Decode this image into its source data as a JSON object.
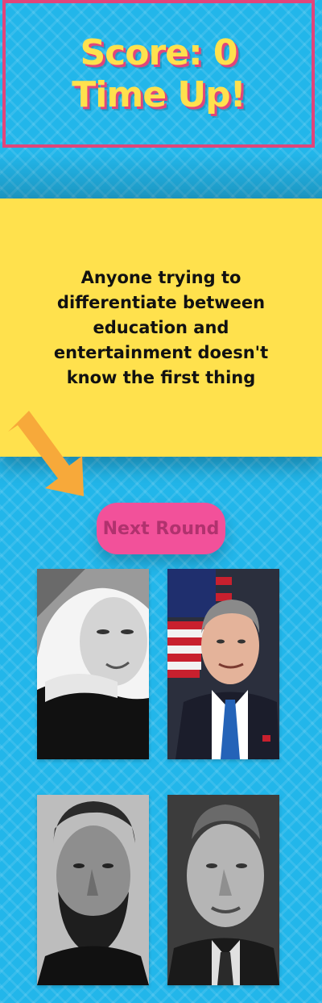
{
  "header": {
    "score_line": "Score: 0",
    "status_line": "Time Up!"
  },
  "quote": {
    "text": "Anyone trying to differentiate between education and entertainment doesn't know the first thing"
  },
  "controls": {
    "next_round_label": "Next Round"
  },
  "colors": {
    "background": "#22b6ea",
    "accent_yellow": "#ffe14d",
    "accent_pink": "#f2519a",
    "border_pink": "#e0457b",
    "arrow_orange": "#f7a93a"
  },
  "portraits": [
    {
      "icon": "portrait-woman-photo"
    },
    {
      "icon": "portrait-man-flag-photo"
    },
    {
      "icon": "portrait-bearded-man-photo"
    },
    {
      "icon": "portrait-elderly-man-photo"
    }
  ]
}
